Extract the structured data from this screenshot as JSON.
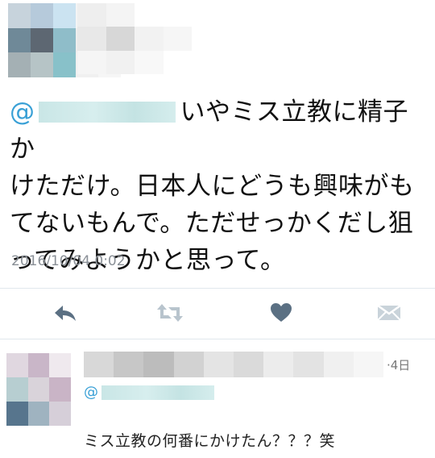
{
  "tweet": {
    "mention_prefix": "@",
    "text_line1": "いやミス立教に精子か",
    "text_line2": "けただけ。日本人にどうも興味がも",
    "text_line3": "てないもんで。ただせっかくだし狙",
    "text_line4": "ってみようかと思って。",
    "timestamp": "2016/10/04 0:02"
  },
  "actions": {
    "reply_icon": "reply-icon",
    "retweet_icon": "retweet-icon",
    "like_icon": "heart-icon",
    "dm_icon": "envelope-icon"
  },
  "reply": {
    "time": "·4日",
    "mention_prefix": "@",
    "text": "ミス立教の何番にかけたん？？？笑"
  },
  "colors": {
    "mention": "#39a0d6",
    "timestamp": "#8a9097",
    "icon": "#8fa3b3",
    "like_icon": "#657786",
    "divider": "#e1e8ed"
  }
}
